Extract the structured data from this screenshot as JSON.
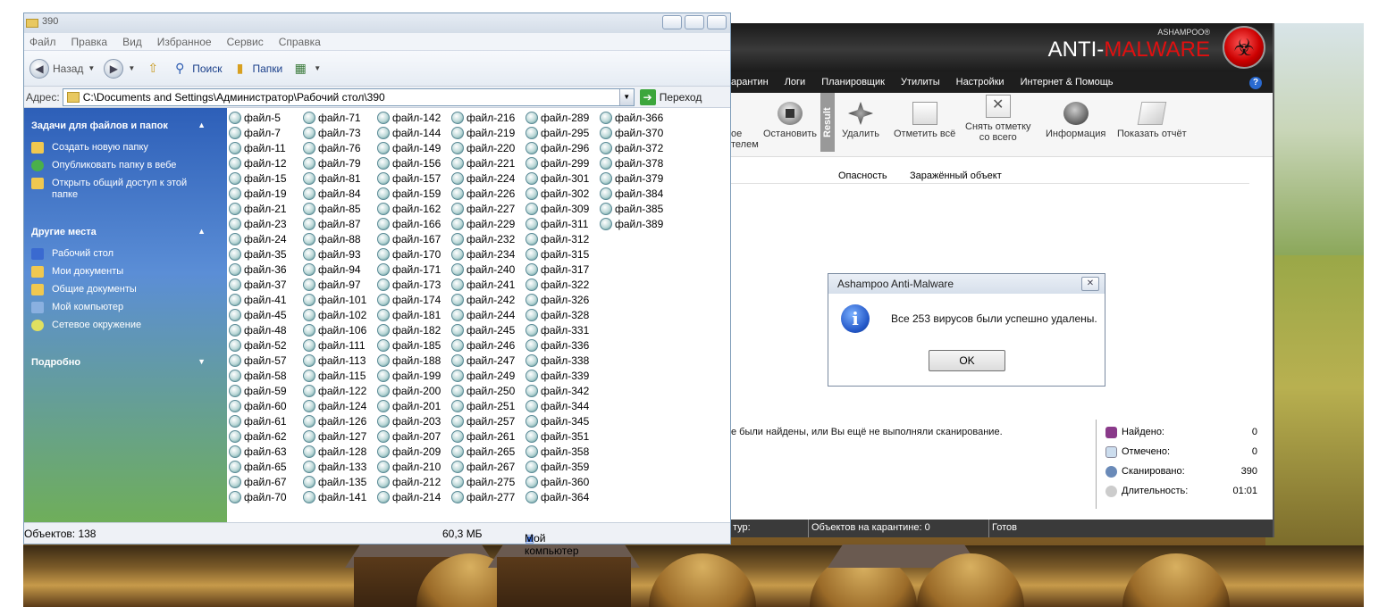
{
  "explorer": {
    "title": "390",
    "menu": [
      "Файл",
      "Правка",
      "Вид",
      "Избранное",
      "Сервис",
      "Справка"
    ],
    "toolbar": {
      "back": "Назад",
      "search": "Поиск",
      "folders": "Папки"
    },
    "address": {
      "label": "Адрес:",
      "path": "C:\\Documents and Settings\\Администратор\\Рабочий стол\\390",
      "go": "Переход"
    },
    "taskpane": {
      "tasks_title": "Задачи для файлов и папок",
      "tasks": [
        "Создать новую папку",
        "Опубликовать папку в вебе",
        "Открыть общий доступ к этой папке"
      ],
      "places_title": "Другие места",
      "places": [
        "Рабочий стол",
        "Мои документы",
        "Общие документы",
        "Мой компьютер",
        "Сетевое окружение"
      ],
      "details_title": "Подробно"
    },
    "columns": [
      [
        "файл-5",
        "файл-7",
        "файл-11",
        "файл-12",
        "файл-15",
        "файл-19",
        "файл-21",
        "файл-23",
        "файл-24",
        "файл-35",
        "файл-36",
        "файл-37",
        "файл-41",
        "файл-45",
        "файл-48",
        "файл-52",
        "файл-57",
        "файл-58",
        "файл-59",
        "файл-60",
        "файл-61",
        "файл-62",
        "файл-63",
        "файл-65",
        "файл-67",
        "файл-70"
      ],
      [
        "файл-71",
        "файл-73",
        "файл-76",
        "файл-79",
        "файл-81",
        "файл-84",
        "файл-85",
        "файл-87",
        "файл-88",
        "файл-93",
        "файл-94",
        "файл-97",
        "файл-101",
        "файл-102",
        "файл-106",
        "файл-111",
        "файл-113",
        "файл-115",
        "файл-122",
        "файл-124",
        "файл-126",
        "файл-127",
        "файл-128",
        "файл-133",
        "файл-135",
        "файл-141"
      ],
      [
        "файл-142",
        "файл-144",
        "файл-149",
        "файл-156",
        "файл-157",
        "файл-159",
        "файл-162",
        "файл-166",
        "файл-167",
        "файл-170",
        "файл-171",
        "файл-173",
        "файл-174",
        "файл-181",
        "файл-182",
        "файл-185",
        "файл-188",
        "файл-199",
        "файл-200",
        "файл-201",
        "файл-203",
        "файл-207",
        "файл-209",
        "файл-210",
        "файл-212",
        "файл-214"
      ],
      [
        "файл-216",
        "файл-219",
        "файл-220",
        "файл-221",
        "файл-224",
        "файл-226",
        "файл-227",
        "файл-229",
        "файл-232",
        "файл-234",
        "файл-240",
        "файл-241",
        "файл-242",
        "файл-244",
        "файл-245",
        "файл-246",
        "файл-247",
        "файл-249",
        "файл-250",
        "файл-251",
        "файл-257",
        "файл-261",
        "файл-265",
        "файл-267",
        "файл-275",
        "файл-277"
      ],
      [
        "файл-289",
        "файл-295",
        "файл-296",
        "файл-299",
        "файл-301",
        "файл-302",
        "файл-309",
        "файл-311",
        "файл-312",
        "файл-315",
        "файл-317",
        "файл-322",
        "файл-326",
        "файл-328",
        "файл-331",
        "файл-336",
        "файл-338",
        "файл-339",
        "файл-342",
        "файл-344",
        "файл-345",
        "файл-351",
        "файл-358",
        "файл-359",
        "файл-360",
        "файл-364"
      ],
      [
        "файл-366",
        "файл-370",
        "файл-372",
        "файл-378",
        "файл-379",
        "файл-384",
        "файл-385",
        "файл-389"
      ]
    ],
    "status": {
      "objects": "Объектов: 138",
      "size": "60,3 МБ",
      "location": "Мой компьютер"
    }
  },
  "ashampoo": {
    "brand_small": "ASHAMPOO®",
    "brand_white": "ANTI-",
    "brand_red": "MALWARE",
    "menu": [
      "арантин",
      "Логи",
      "Планировщик",
      "Утилиты",
      "Настройки",
      "Интернет & Помощь"
    ],
    "toolbar": {
      "cut_label_1": "ое",
      "cut_label_2": "телем",
      "stop": "Остановить",
      "result_tab": "Result",
      "delete": "Удалить",
      "check_all": "Отметить всё",
      "uncheck_1": "Снять отметку",
      "uncheck_2": "со всего",
      "info": "Информация",
      "report": "Показать отчёт"
    },
    "columns": [
      "Опасность",
      "Заражённый объект"
    ],
    "message": "е были найдены, или Вы ещё не выполняли сканирование.",
    "stats": [
      {
        "label": "Найдено:",
        "value": "0"
      },
      {
        "label": "Отмечено:",
        "value": "0"
      },
      {
        "label": "Сканировано:",
        "value": "390"
      },
      {
        "label": "Длительность:",
        "value": "01:01"
      }
    ],
    "status": {
      "left": "тур:",
      "quarantine": "Объектов на карантине: 0",
      "ready": "Готов"
    }
  },
  "dialog": {
    "title": "Ashampoo Anti-Malware",
    "message": "Все 253 вирусов были успешно удалены.",
    "ok": "OK"
  }
}
